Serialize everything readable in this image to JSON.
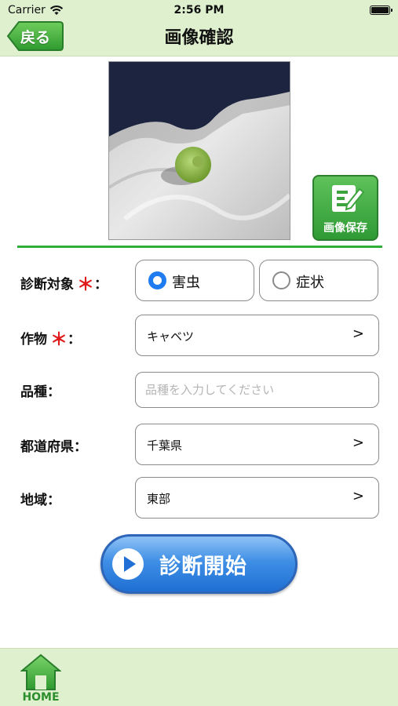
{
  "status_bar": {
    "carrier": "Carrier",
    "time": "2:56 PM"
  },
  "nav": {
    "back_label": "戻る",
    "title": "画像確認"
  },
  "photo_panel": {
    "save_label": "画像保存"
  },
  "form": {
    "target": {
      "label": "診断対象",
      "required_mark": "＊",
      "colon": "：",
      "options": [
        {
          "label": "害虫",
          "selected": true
        },
        {
          "label": "症状",
          "selected": false
        }
      ]
    },
    "crop": {
      "label": "作物",
      "required_mark": "＊",
      "colon": "：",
      "value": "キャベツ",
      "chevron": ">"
    },
    "variety": {
      "label": "品種：",
      "placeholder": "品種を入力してください",
      "value": ""
    },
    "prefecture": {
      "label": "都道府県：",
      "value": "千葉県",
      "chevron": ">"
    },
    "region": {
      "label": "地域：",
      "value": "東部",
      "chevron": ">"
    }
  },
  "start_button": {
    "label": "診断開始"
  },
  "bottom_bar": {
    "home_label": "HOME"
  },
  "colors": {
    "bar_bg": "#dff0cf",
    "accent_green": "#2fae3a",
    "required_red": "#e01a1a",
    "radio_blue": "#1e7cf0",
    "button_blue": "#1f6fd4"
  }
}
